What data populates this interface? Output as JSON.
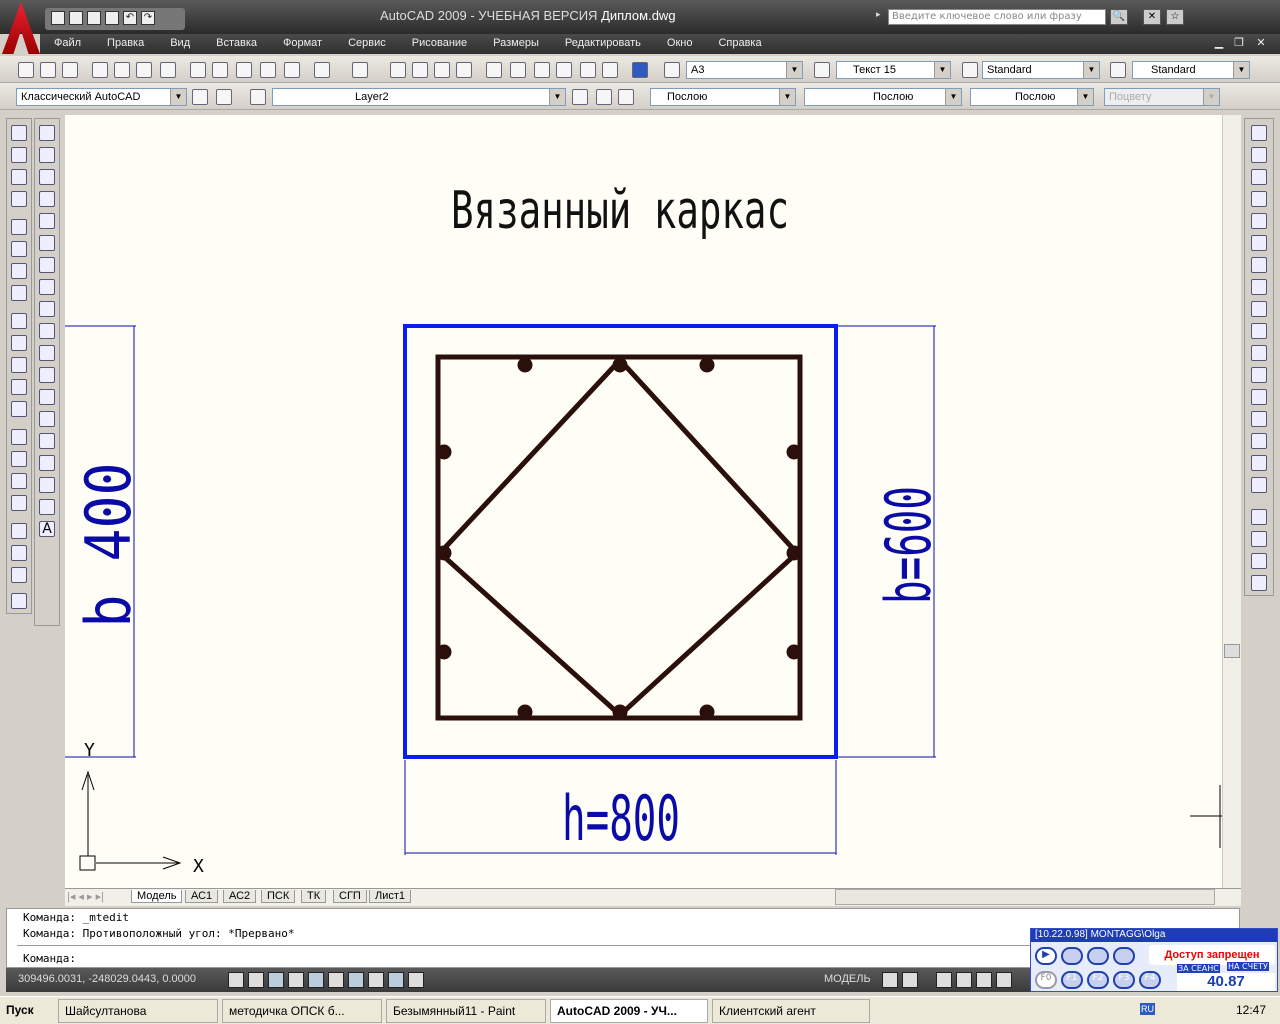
{
  "window": {
    "title_prefix": "AutoCAD 2009 - УЧЕБНАЯ ВЕРСИЯ",
    "file": "Диплом.dwg",
    "search_placeholder": "Введите ключевое слово или фразу"
  },
  "menu": [
    "Файл",
    "Правка",
    "Вид",
    "Вставка",
    "Формат",
    "Сервис",
    "Рисование",
    "Размеры",
    "Редактировать",
    "Окно",
    "Справка"
  ],
  "toolbar1": {
    "text_style": "A3",
    "dim_style": "Текст 15",
    "table_style": "Standard",
    "mleader_style": "Standard"
  },
  "toolbar2": {
    "workspace": "Классический AutoCAD",
    "layer": "Layer2",
    "color": "Послою",
    "linetype": "Послою",
    "lineweight": "Послою",
    "plotstyle": "Поцвету"
  },
  "drawing": {
    "title": "Вязанный каркас",
    "dim_left": "b 400",
    "dim_right": "b=600",
    "dim_bottom": "h=800",
    "ucs_x": "X",
    "ucs_y": "Y",
    "colors": {
      "outer": "#0a1ef0",
      "cage": "#2b0f0a",
      "dim": "#0a0aa8"
    }
  },
  "layout_tabs": [
    "Модель",
    "АС1",
    "АС2",
    "ПСК",
    "ТК",
    "СГП",
    "Лист1"
  ],
  "command": {
    "lines": [
      "Команда: _mtedit",
      "Команда: Противоположный угол: *Прервано*"
    ],
    "prompt": "Команда:"
  },
  "status": {
    "coords": "309496.0031, -248029.0443, 0.0000",
    "model": "МОДЕЛЬ"
  },
  "agent": {
    "header": "[10.22.0.98] MONTAGG\\Olga",
    "access": "Доступ запрещен",
    "session": "ЗА СЕАНС",
    "account": "НА СЧЕТУ",
    "amount": "40.87",
    "fkeys": [
      "F0",
      "F1",
      "F2",
      "F3",
      "F4"
    ]
  },
  "taskbar": {
    "start": "Пуск",
    "tasks": [
      "Шайсултанова",
      "методичка ОПСК б...",
      "Безымянный11 - Paint",
      "AutoCAD 2009 - УЧ...",
      "Клиентский агент"
    ],
    "lang": "RU",
    "clock": "12:47"
  }
}
